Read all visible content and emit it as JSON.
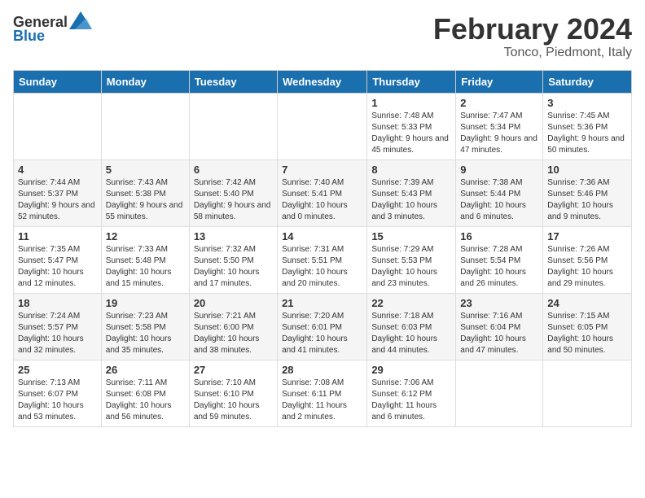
{
  "header": {
    "logo_general": "General",
    "logo_blue": "Blue",
    "month_title": "February 2024",
    "location": "Tonco, Piedmont, Italy"
  },
  "calendar": {
    "days_of_week": [
      "Sunday",
      "Monday",
      "Tuesday",
      "Wednesday",
      "Thursday",
      "Friday",
      "Saturday"
    ],
    "weeks": [
      [
        {
          "day": "",
          "info": ""
        },
        {
          "day": "",
          "info": ""
        },
        {
          "day": "",
          "info": ""
        },
        {
          "day": "",
          "info": ""
        },
        {
          "day": "1",
          "info": "Sunrise: 7:48 AM\nSunset: 5:33 PM\nDaylight: 9 hours\nand 45 minutes."
        },
        {
          "day": "2",
          "info": "Sunrise: 7:47 AM\nSunset: 5:34 PM\nDaylight: 9 hours\nand 47 minutes."
        },
        {
          "day": "3",
          "info": "Sunrise: 7:45 AM\nSunset: 5:36 PM\nDaylight: 9 hours\nand 50 minutes."
        }
      ],
      [
        {
          "day": "4",
          "info": "Sunrise: 7:44 AM\nSunset: 5:37 PM\nDaylight: 9 hours\nand 52 minutes."
        },
        {
          "day": "5",
          "info": "Sunrise: 7:43 AM\nSunset: 5:38 PM\nDaylight: 9 hours\nand 55 minutes."
        },
        {
          "day": "6",
          "info": "Sunrise: 7:42 AM\nSunset: 5:40 PM\nDaylight: 9 hours\nand 58 minutes."
        },
        {
          "day": "7",
          "info": "Sunrise: 7:40 AM\nSunset: 5:41 PM\nDaylight: 10 hours\nand 0 minutes."
        },
        {
          "day": "8",
          "info": "Sunrise: 7:39 AM\nSunset: 5:43 PM\nDaylight: 10 hours\nand 3 minutes."
        },
        {
          "day": "9",
          "info": "Sunrise: 7:38 AM\nSunset: 5:44 PM\nDaylight: 10 hours\nand 6 minutes."
        },
        {
          "day": "10",
          "info": "Sunrise: 7:36 AM\nSunset: 5:46 PM\nDaylight: 10 hours\nand 9 minutes."
        }
      ],
      [
        {
          "day": "11",
          "info": "Sunrise: 7:35 AM\nSunset: 5:47 PM\nDaylight: 10 hours\nand 12 minutes."
        },
        {
          "day": "12",
          "info": "Sunrise: 7:33 AM\nSunset: 5:48 PM\nDaylight: 10 hours\nand 15 minutes."
        },
        {
          "day": "13",
          "info": "Sunrise: 7:32 AM\nSunset: 5:50 PM\nDaylight: 10 hours\nand 17 minutes."
        },
        {
          "day": "14",
          "info": "Sunrise: 7:31 AM\nSunset: 5:51 PM\nDaylight: 10 hours\nand 20 minutes."
        },
        {
          "day": "15",
          "info": "Sunrise: 7:29 AM\nSunset: 5:53 PM\nDaylight: 10 hours\nand 23 minutes."
        },
        {
          "day": "16",
          "info": "Sunrise: 7:28 AM\nSunset: 5:54 PM\nDaylight: 10 hours\nand 26 minutes."
        },
        {
          "day": "17",
          "info": "Sunrise: 7:26 AM\nSunset: 5:56 PM\nDaylight: 10 hours\nand 29 minutes."
        }
      ],
      [
        {
          "day": "18",
          "info": "Sunrise: 7:24 AM\nSunset: 5:57 PM\nDaylight: 10 hours\nand 32 minutes."
        },
        {
          "day": "19",
          "info": "Sunrise: 7:23 AM\nSunset: 5:58 PM\nDaylight: 10 hours\nand 35 minutes."
        },
        {
          "day": "20",
          "info": "Sunrise: 7:21 AM\nSunset: 6:00 PM\nDaylight: 10 hours\nand 38 minutes."
        },
        {
          "day": "21",
          "info": "Sunrise: 7:20 AM\nSunset: 6:01 PM\nDaylight: 10 hours\nand 41 minutes."
        },
        {
          "day": "22",
          "info": "Sunrise: 7:18 AM\nSunset: 6:03 PM\nDaylight: 10 hours\nand 44 minutes."
        },
        {
          "day": "23",
          "info": "Sunrise: 7:16 AM\nSunset: 6:04 PM\nDaylight: 10 hours\nand 47 minutes."
        },
        {
          "day": "24",
          "info": "Sunrise: 7:15 AM\nSunset: 6:05 PM\nDaylight: 10 hours\nand 50 minutes."
        }
      ],
      [
        {
          "day": "25",
          "info": "Sunrise: 7:13 AM\nSunset: 6:07 PM\nDaylight: 10 hours\nand 53 minutes."
        },
        {
          "day": "26",
          "info": "Sunrise: 7:11 AM\nSunset: 6:08 PM\nDaylight: 10 hours\nand 56 minutes."
        },
        {
          "day": "27",
          "info": "Sunrise: 7:10 AM\nSunset: 6:10 PM\nDaylight: 10 hours\nand 59 minutes."
        },
        {
          "day": "28",
          "info": "Sunrise: 7:08 AM\nSunset: 6:11 PM\nDaylight: 11 hours\nand 2 minutes."
        },
        {
          "day": "29",
          "info": "Sunrise: 7:06 AM\nSunset: 6:12 PM\nDaylight: 11 hours\nand 6 minutes."
        },
        {
          "day": "",
          "info": ""
        },
        {
          "day": "",
          "info": ""
        }
      ]
    ]
  }
}
